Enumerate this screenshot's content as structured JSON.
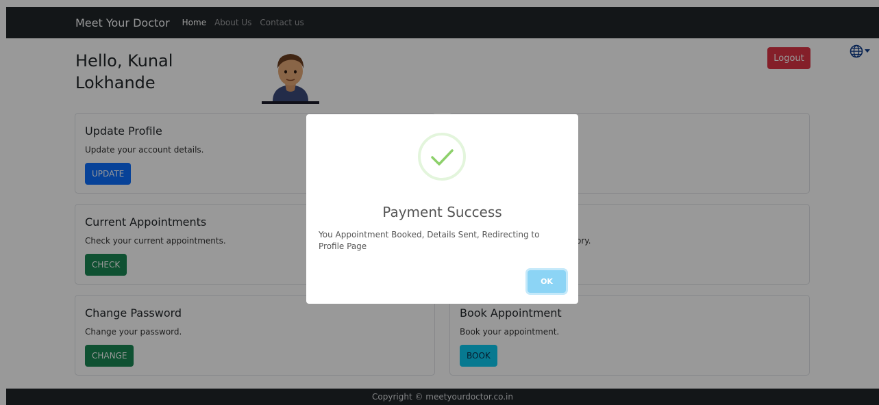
{
  "navbar": {
    "brand": "Meet Your Doctor",
    "links": [
      "Home",
      "About Us",
      "Contact us"
    ]
  },
  "header": {
    "greeting_line1": "Hello, Kunal",
    "greeting_line2": "Lokhande",
    "logout_label": "Logout",
    "language_icon": "globe-icon"
  },
  "cards": [
    {
      "title": "Update Profile",
      "text": "Update your account details.",
      "button": "UPDATE",
      "color": "#0d6efd"
    },
    {
      "title": "",
      "text": "",
      "button": "",
      "color": ""
    },
    {
      "title": "Current Appointments",
      "text": "Check your current appointments.",
      "button": "CHECK",
      "color": "#198754"
    },
    {
      "title": "",
      "text": "ory.",
      "button": "",
      "color": ""
    },
    {
      "title": "Change Password",
      "text": "Change your password.",
      "button": "CHANGE",
      "color": "#198754"
    },
    {
      "title": "Book Appointment",
      "text": "Book your appointment.",
      "button": "BOOK",
      "color": "#0dcaf0"
    }
  ],
  "footer": {
    "copyright": "Copyright © meetyourdoctor.co.in"
  },
  "modal": {
    "icon": "success-check-icon",
    "title": "Payment Success",
    "message": "You Appointment Booked, Details Sent, Redirecting to Profile Page",
    "ok_label": "OK",
    "ok_color": "#8cd4f5"
  }
}
